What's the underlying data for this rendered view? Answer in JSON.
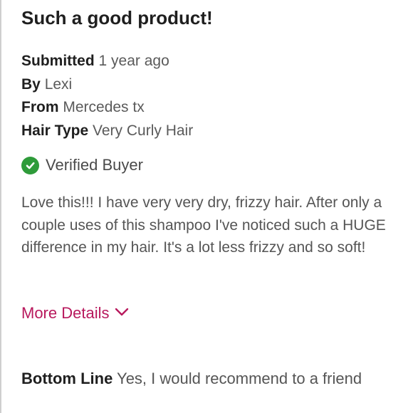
{
  "review": {
    "title": "Such a good product!",
    "submitted": {
      "key": "Submitted",
      "value": "1 year ago"
    },
    "by": {
      "key": "By",
      "value": "Lexi"
    },
    "from": {
      "key": "From",
      "value": "Mercedes tx"
    },
    "hair_type": {
      "key": "Hair Type",
      "value": "Very Curly Hair"
    },
    "verified": {
      "label": "Verified Buyer",
      "icon": "check-circle-icon",
      "color": "#2e9b3a"
    },
    "body": "Love this!!! I have very very dry, frizzy hair. After only a couple uses of this shampoo I've noticed such a HUGE difference in my hair. It's a lot less frizzy and so soft!",
    "more_details": {
      "label": "More Details",
      "icon": "chevron-down-icon",
      "color": "#b8195d"
    },
    "bottom_line": {
      "key": "Bottom Line",
      "value": "Yes, I would recommend to a friend"
    }
  }
}
